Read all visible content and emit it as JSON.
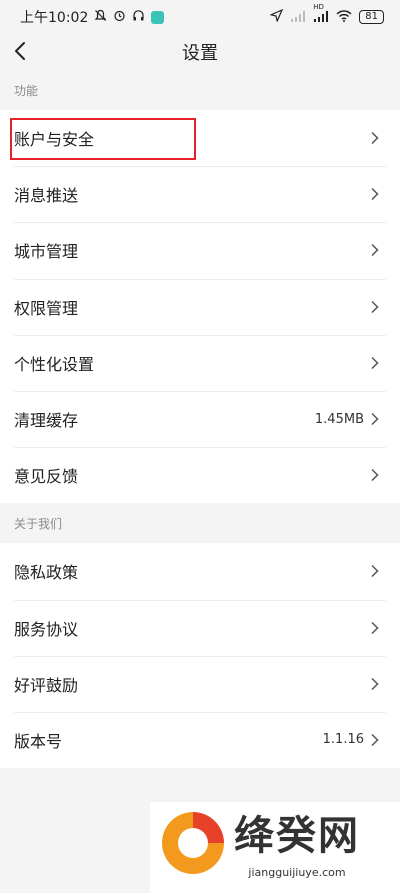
{
  "status_bar": {
    "time": "上午10:02",
    "signal_label": "HD",
    "battery": "81"
  },
  "header": {
    "title": "设置"
  },
  "sections": [
    {
      "label": "功能",
      "items": [
        {
          "label": "账户与安全",
          "value": ""
        },
        {
          "label": "消息推送",
          "value": ""
        },
        {
          "label": "城市管理",
          "value": ""
        },
        {
          "label": "权限管理",
          "value": ""
        },
        {
          "label": "个性化设置",
          "value": ""
        },
        {
          "label": "清理缓存",
          "value": "1.45MB"
        },
        {
          "label": "意见反馈",
          "value": ""
        }
      ]
    },
    {
      "label": "关于我们",
      "items": [
        {
          "label": "隐私政策",
          "value": ""
        },
        {
          "label": "服务协议",
          "value": ""
        },
        {
          "label": "好评鼓励",
          "value": ""
        },
        {
          "label": "版本号",
          "value": "1.1.16"
        }
      ]
    }
  ],
  "watermark": {
    "title": "绛癸网",
    "url": "jiangguijiuye.com"
  },
  "colors": {
    "highlight": "#e5222a",
    "logo_orange": "#f39a1e",
    "logo_red": "#e8412a"
  }
}
